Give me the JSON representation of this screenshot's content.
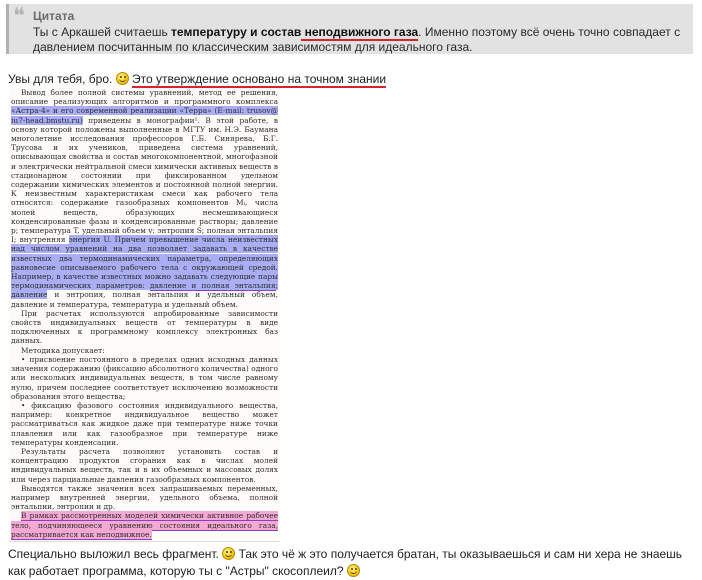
{
  "quote": {
    "title": "Цитата",
    "text_part1": "Ты с Аркашей считаешь ",
    "text_bold1": "температуру и состав",
    "text_bold2": " неподвижного газа",
    "text_part2": ". Именно поэтому всё очень точно совпадает с давлением посчитанным по классическим зависимостям для идеального газа."
  },
  "post": {
    "line1_part1": "Увы для тебя, бро.",
    "line1_part2": "Это утверждение основано ",
    "line1_underlined": "на точном знании",
    "line2_part1": "Специально выложил весь фрагмент.",
    "line2_part2": "Так это чё ж это получается братан, ты оказываешься и сам ни хера не знаешь как работает программа, которую ты с \"Астры\" скосоплеил?"
  },
  "scan": {
    "p1_a": "Вывод более полной системы уравнений, метод ее решения, описание реализующих алгоритмов и программного комплекса ",
    "p1_hl": "«Астра-4» и его современной реализации «Терра» (E-mail: trusov@ iu7-head.bmstu.ru)",
    "p1_b": " приведены в монографии¹. В этой работе, в основу которой положены выполненные в МГТУ им. Н.Э. Баумана многолетние исследования профессоров Г.Б. Синярева, Б.Г. Трусова и их учеников, приведена система уравнений, описывающая свойства и состав многокомпонентной, многофазной и электрически нейтральной смеси химически активных веществ в стационарном состоянии при фиксированном удельном содержании химических элементов и постоянной полной энергии. К неизвестным характеристикам смеси как рабочего тела относятся: содержание газообразных компонентов Mᵢ, числа молей веществ, образующих несмешивающиеся конденсированные фазы и конденсированные растворы; давление p; температура T, удельный объем v; энтропия S; полная энтальпия I; внутренняя ",
    "p1_hl2": "энергия U. Причем превышение числа неизвестных над числом уравнений на два позволяет задавать в качестве известных два термодинамических параметра, определяющих равновесие описываемого рабочего тела с окружающей средой. Например, в качестве известных можно задавать следующие пары термодинамических параметров: ",
    "p1_hl2_u": "давление и полная энтальпия",
    "p1_hl2_end": "; давление",
    "p1_c": " и энтропия, полная энтальпия и удельный объем, давление и температура, температура и удельный объем.",
    "p2": "При расчетах используются апробированные зависимости свойств индивидуальных веществ от температуры в виде подключенных к программному комплексу электронных баз данных.",
    "p3": "Методика допускает:",
    "p4": "• присвоение постоянного в пределах одних исходных данных значения содержанию (фиксацию абсолютного количества) одного или нескольких индивидуальных веществ, в том числе равному нулю, причем последнее соответствует исключению возможности образования этого вещества;",
    "p5": "• фиксацию фазового состояния индивидуального вещества, например: конкретное индивидуальное вещество может рассматриваться как жидкое даже при температуре ниже точки плавления или как газообразное при температуре ниже температуры конденсации.",
    "p6": "Результаты расчета позволяют установить состав и концентрацию продуктов сгорания как в числах молей индивидуальных веществ, так и в их объемных и массовых долях или через парциальные давления газообразных компонентов.",
    "p7": "Выводятся также значения всех запрашиваемых переменных, например внутренней энергии, удельного объема, полной энтальпии, энтропии и др.",
    "p8_hl": "В рамках рассмотренных моделей химически активное рабочее тело, подчиняющееся уравнению состояния идеального газа, рассматривается как неподвижное."
  },
  "colors": {
    "quote_bg": "#e2e2e2",
    "underline_red": "#d4242c",
    "highlight_blue": "#a9aef5",
    "highlight_pink": "#f4a9d4"
  }
}
